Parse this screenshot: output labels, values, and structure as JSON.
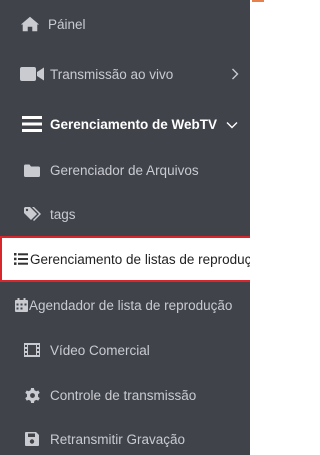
{
  "menu": {
    "items": [
      {
        "label": "Páinel",
        "icon": "home-icon"
      },
      {
        "label": "Transmissão ao vivo",
        "icon": "video-camera-icon"
      },
      {
        "label": "Gerenciamento de WebTV",
        "icon": "bars-icon"
      },
      {
        "label": "Gerenciador de Arquivos",
        "icon": "folder-icon"
      },
      {
        "label": "tags",
        "icon": "tags-icon"
      },
      {
        "label": "Gerenciamento de listas de reprodução",
        "icon": "list-icon"
      },
      {
        "label": "Agendador de lista de reprodução",
        "icon": "calendar-icon"
      },
      {
        "label": "Vídeo Comercial",
        "icon": "film-icon"
      },
      {
        "label": "Controle de transmissão",
        "icon": "cog-icon"
      },
      {
        "label": "Retransmitir Gravação",
        "icon": "save-icon"
      }
    ]
  },
  "colors": {
    "sidebar_bg": "#41434b",
    "text": "#c9cbd1",
    "active_bg": "#ffffff",
    "highlight_border": "#d9262c"
  }
}
